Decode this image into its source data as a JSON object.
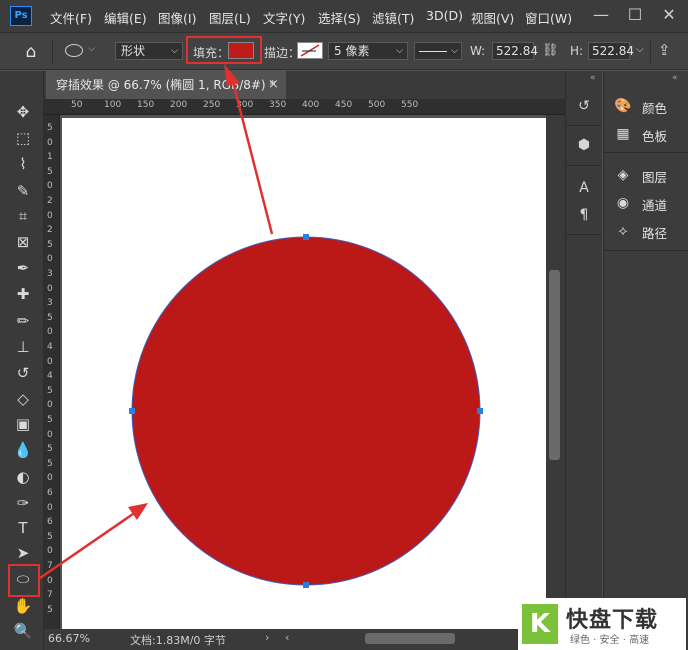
{
  "app": {
    "logo": "Ps"
  },
  "menu": [
    "文件(F)",
    "编辑(E)",
    "图像(I)",
    "图层(L)",
    "文字(Y)",
    "选择(S)",
    "滤镜(T)",
    "3D(D)",
    "视图(V)",
    "窗口(W)"
  ],
  "window_buttons": {
    "minimize": "—",
    "maximize": "☐",
    "close": "✕"
  },
  "options_bar": {
    "mode_value": "形状",
    "fill_label": "填充：",
    "fill_color": "#c01b1b",
    "stroke_label": "描边：",
    "stroke_width": "5 像素",
    "w_label": "W:",
    "w_value": "522.84",
    "h_label": "H:",
    "h_value": "522.84"
  },
  "document_tab": {
    "title": "穿插效果 @ 66.7% (椭圆 1, RGB/8#) *",
    "close": "×"
  },
  "ruler_top_ticks": [
    "50",
    "100",
    "150",
    "200",
    "250",
    "300",
    "350",
    "400",
    "450",
    "500",
    "550"
  ],
  "ruler_left_ticks": [
    "5",
    "0",
    "1",
    "5",
    "0",
    "2",
    "0",
    "2",
    "5",
    "0",
    "3",
    "0",
    "3",
    "5",
    "0",
    "4",
    "0",
    "4",
    "5",
    "0",
    "5",
    "0",
    "5",
    "5",
    "0",
    "6",
    "0",
    "6",
    "5",
    "0",
    "7",
    "0",
    "7",
    "5"
  ],
  "tools": [
    {
      "name": "move-tool-icon",
      "glyph": "✥"
    },
    {
      "name": "marquee-tool-icon",
      "glyph": "⬚"
    },
    {
      "name": "lasso-tool-icon",
      "glyph": "⌇"
    },
    {
      "name": "quick-select-tool-icon",
      "glyph": "✎"
    },
    {
      "name": "crop-tool-icon",
      "glyph": "⌗"
    },
    {
      "name": "frame-tool-icon",
      "glyph": "⊠"
    },
    {
      "name": "eyedropper-tool-icon",
      "glyph": "✒"
    },
    {
      "name": "healing-brush-tool-icon",
      "glyph": "✚"
    },
    {
      "name": "brush-tool-icon",
      "glyph": "✏"
    },
    {
      "name": "clone-stamp-tool-icon",
      "glyph": "⊥"
    },
    {
      "name": "history-brush-tool-icon",
      "glyph": "↺"
    },
    {
      "name": "eraser-tool-icon",
      "glyph": "◇"
    },
    {
      "name": "gradient-tool-icon",
      "glyph": "▣"
    },
    {
      "name": "blur-tool-icon",
      "glyph": "💧"
    },
    {
      "name": "dodge-tool-icon",
      "glyph": "◐"
    },
    {
      "name": "pen-tool-icon",
      "glyph": "✑"
    },
    {
      "name": "type-tool-icon",
      "glyph": "T"
    },
    {
      "name": "path-select-tool-icon",
      "glyph": "➤"
    },
    {
      "name": "ellipse-tool-icon",
      "glyph": "⬭"
    },
    {
      "name": "hand-tool-icon",
      "glyph": "✋"
    },
    {
      "name": "zoom-tool-icon",
      "glyph": "🔍"
    }
  ],
  "canvas": {
    "shape_color": "#bb1818",
    "anchor_color": "#2b7fe0"
  },
  "status": {
    "zoom": "66.67%",
    "doc": "文档:1.83M/0 字节"
  },
  "panels": [
    {
      "name": "color",
      "label": "颜色",
      "icon": "palette-icon"
    },
    {
      "name": "swatches",
      "label": "色板",
      "icon": "grid-icon"
    },
    {
      "name": "layers",
      "label": "图层",
      "icon": "layers-icon"
    },
    {
      "name": "channels",
      "label": "通道",
      "icon": "channels-icon"
    },
    {
      "name": "paths",
      "label": "路径",
      "icon": "paths-icon"
    }
  ],
  "watermark": {
    "brand": "快盘下载",
    "tagline": "绿色 · 安全 · 高速",
    "logo_letter": "K"
  }
}
